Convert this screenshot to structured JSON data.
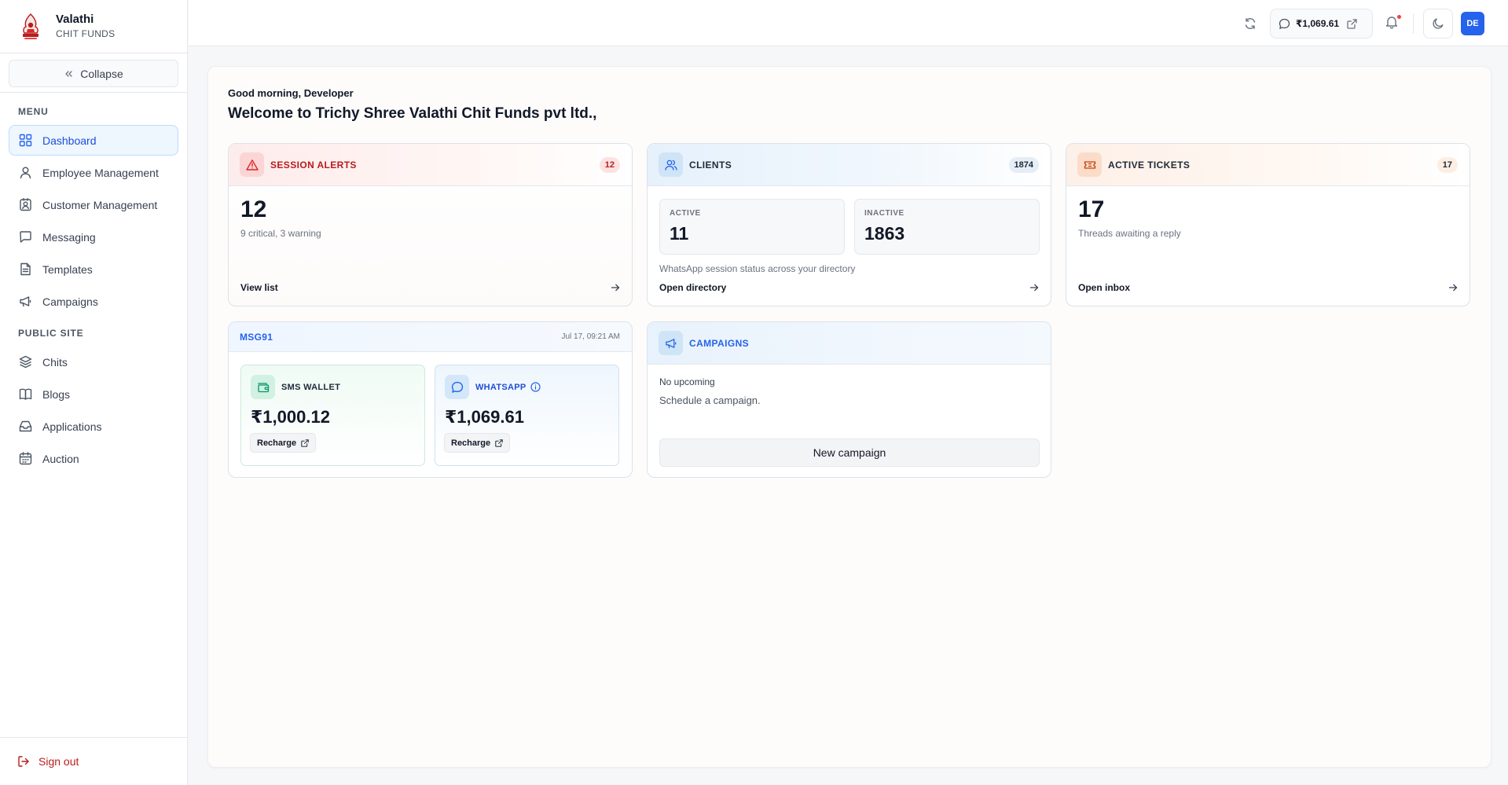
{
  "brand": {
    "name": "Valathi",
    "subtitle": "CHIT FUNDS"
  },
  "sidebar": {
    "collapse_label": "Collapse",
    "menu_heading": "MENU",
    "menu_items": [
      {
        "label": "Dashboard",
        "icon": "grid-icon",
        "active": true
      },
      {
        "label": "Employee Management",
        "icon": "user-icon"
      },
      {
        "label": "Customer Management",
        "icon": "contact-icon"
      },
      {
        "label": "Messaging",
        "icon": "message-square-icon"
      },
      {
        "label": "Templates",
        "icon": "file-text-icon"
      },
      {
        "label": "Campaigns",
        "icon": "megaphone-icon"
      }
    ],
    "public_heading": "PUBLIC SITE",
    "public_items": [
      {
        "label": "Chits",
        "icon": "layers-icon"
      },
      {
        "label": "Blogs",
        "icon": "book-icon"
      },
      {
        "label": "Applications",
        "icon": "inbox-icon"
      },
      {
        "label": "Auction",
        "icon": "calendar-icon"
      }
    ],
    "sign_out": "Sign out"
  },
  "topbar": {
    "wallet_balance": "₹1,069.61",
    "avatar_initials": "DE",
    "has_notification": true
  },
  "greeting": {
    "small": "Good morning, Developer",
    "title": "Welcome to Trichy Shree Valathi Chit Funds pvt ltd.,"
  },
  "session_alerts": {
    "title": "SESSION ALERTS",
    "badge": "12",
    "count": "12",
    "detail": "9 critical, 3 warning",
    "link": "View list"
  },
  "clients": {
    "title": "CLIENTS",
    "badge": "1874",
    "active_label": "ACTIVE",
    "active_value": "11",
    "inactive_label": "INACTIVE",
    "inactive_value": "1863",
    "note": "WhatsApp session status across your directory",
    "link": "Open directory"
  },
  "tickets": {
    "title": "ACTIVE TICKETS",
    "badge": "17",
    "count": "17",
    "detail": "Threads awaiting a reply",
    "link": "Open inbox"
  },
  "msg91": {
    "title": "MSG91",
    "date": "Jul 17, 09:21 AM",
    "sms": {
      "title": "SMS WALLET",
      "amount": "₹1,000.12",
      "action": "Recharge"
    },
    "whatsapp": {
      "title": "WHATSAPP",
      "amount": "₹1,069.61",
      "action": "Recharge"
    }
  },
  "campaigns": {
    "title": "CAMPAIGNS",
    "status": "No upcoming",
    "hint": "Schedule a campaign.",
    "button": "New campaign"
  },
  "colors": {
    "accent": "#2563eb",
    "danger": "#b91c1c",
    "active_nav_bg": "#eef6fe"
  }
}
